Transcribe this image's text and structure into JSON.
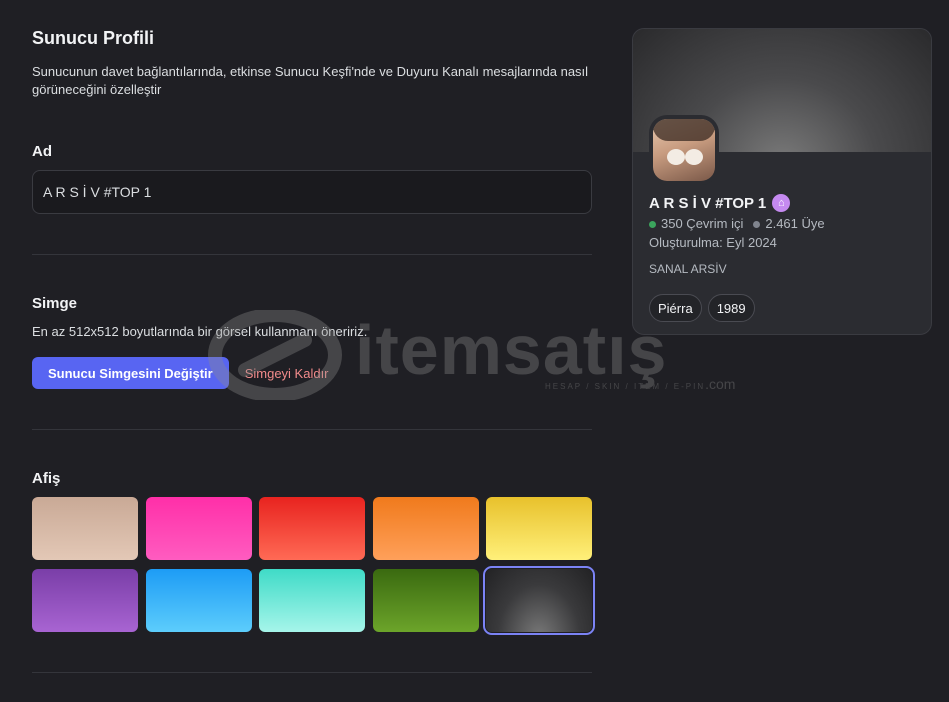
{
  "header": {
    "title": "Sunucu Profili",
    "description": "Sunucunun davet bağlantılarında, etkinse Sunucu Keşfi'nde ve Duyuru Kanalı mesajlarında nasıl görüneceğini özelleştir"
  },
  "name_section": {
    "label": "Ad",
    "value": "A R S İ V #TOP 1"
  },
  "icon_section": {
    "label": "Simge",
    "hint": "En az 512x512 boyutlarında bir görsel kullanmanı öneririz.",
    "change_button": "Sunucu Simgesini Değiştir",
    "remove_button": "Simgeyi Kaldır"
  },
  "banner_section": {
    "label": "Afiş",
    "swatches": [
      {
        "name": "beige",
        "gradient": "linear-gradient(180deg,#c9a996 0%,#e3c8b6 100%)"
      },
      {
        "name": "pink",
        "gradient": "linear-gradient(180deg,#ff2fa8 0%,#ff5cc0 100%)"
      },
      {
        "name": "red",
        "gradient": "linear-gradient(180deg,#e8231f 0%,#ff6a55 100%)"
      },
      {
        "name": "orange",
        "gradient": "linear-gradient(180deg,#f07a1c 0%,#ffa05a 100%)"
      },
      {
        "name": "yellow",
        "gradient": "linear-gradient(180deg,#e8c12c 0%,#fff07a 100%)"
      },
      {
        "name": "purple",
        "gradient": "linear-gradient(180deg,#7a3ea8 0%,#a864d2 100%)"
      },
      {
        "name": "blue",
        "gradient": "linear-gradient(180deg,#1d9cf5 0%,#5ccdfc 100%)"
      },
      {
        "name": "teal",
        "gradient": "linear-gradient(180deg,#3fdbc7 0%,#a6f5ea 100%)"
      },
      {
        "name": "green",
        "gradient": "linear-gradient(180deg,#3a6a10 0%,#6ca42a 100%)"
      },
      {
        "name": "dark",
        "gradient": "radial-gradient(ellipse at 50% 110%,#7a7a7a 0%,#3a3a3c 55%,#222224 100%)",
        "selected": true
      }
    ]
  },
  "preview_card": {
    "server_name": "A R S İ V #TOP 1",
    "online": "350 Çevrim içi",
    "members": "2.461 Üye",
    "created": "Oluşturulma: Eyl 2024",
    "description": "SANAL ARSİV",
    "tags": [
      "Piérra",
      "1989"
    ]
  },
  "watermark": {
    "text": "itemsatış",
    "sub": "HESAP / SKIN / ITEM / E-PIN",
    "com": ".com"
  },
  "colors": {
    "accent": "#5865f2",
    "danger_text": "#f28b8b",
    "online": "#3ba55d"
  }
}
